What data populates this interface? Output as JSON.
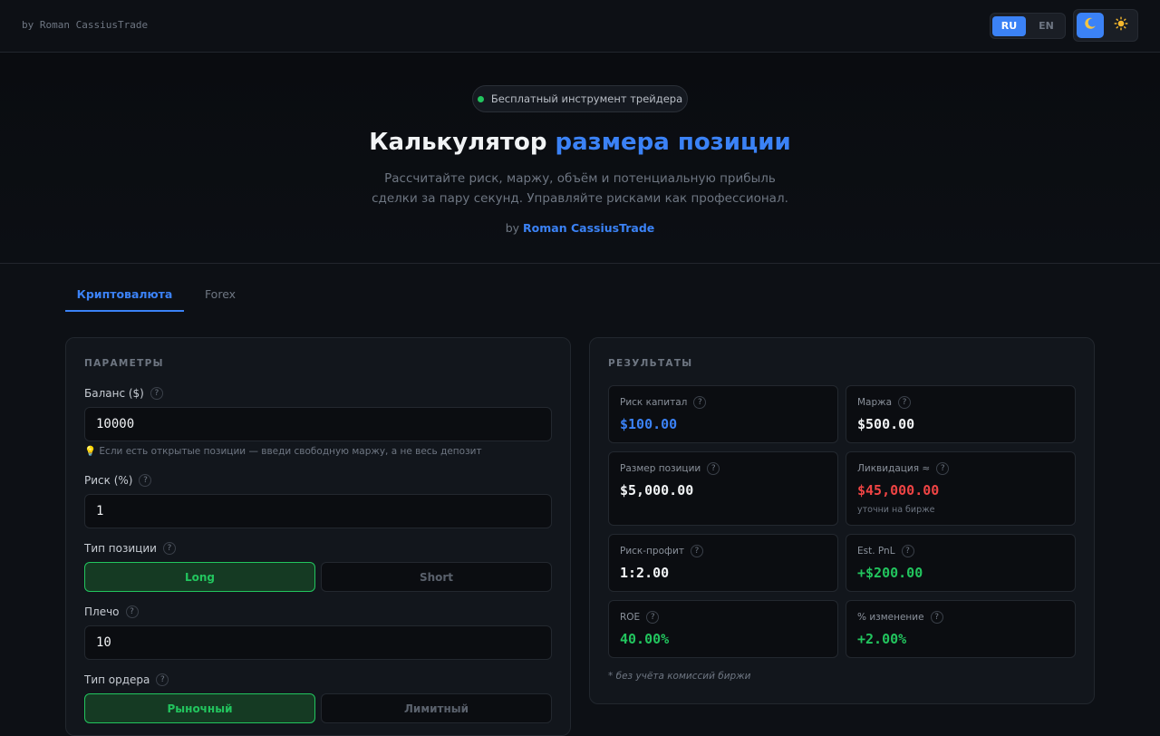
{
  "header": {
    "brand": "by Roman CassiusTrade",
    "languages": [
      {
        "label": "RU",
        "active": true
      },
      {
        "label": "EN",
        "active": false
      }
    ],
    "themes": [
      {
        "icon": "moon-icon",
        "glyph": "🌙",
        "active": true
      },
      {
        "icon": "sun-icon",
        "glyph": "☀️",
        "active": false
      }
    ]
  },
  "hero": {
    "badge": "Бесплатный инструмент трейдера",
    "title_main": "Калькулятор ",
    "title_accent": "размера позиции",
    "subtitle": "Рассчитайте риск, маржу, объём и потенциальную прибыль сделки за пару секунд. Управляйте рисками как профессионал.",
    "by_prefix": "by ",
    "by_name": "Roman CassiusTrade"
  },
  "tabs": [
    {
      "label": "Криптовалюта",
      "active": true
    },
    {
      "label": "Forex",
      "active": false
    }
  ],
  "params": {
    "heading": "ПАРАМЕТРЫ",
    "balance": {
      "label": "Баланс ($)",
      "value": "10000"
    },
    "balance_hint": "💡 Если есть открытые позиции — введи свободную маржу, а не весь депозит",
    "risk": {
      "label": "Риск (%)",
      "value": "1"
    },
    "position_type": {
      "label": "Тип позиции",
      "options": [
        "Long",
        "Short"
      ],
      "selected": "Long"
    },
    "leverage": {
      "label": "Плечо",
      "value": "10"
    },
    "order_type": {
      "label": "Тип ордера",
      "options": [
        "Рыночный",
        "Лимитный"
      ],
      "selected": "Рыночный"
    }
  },
  "results": {
    "heading": "РЕЗУЛЬТАТЫ",
    "cards": [
      {
        "label": "Риск капитал",
        "value": "$100.00",
        "color": "#3b82f6"
      },
      {
        "label": "Маржа",
        "value": "$500.00",
        "color": "#f1f3f5"
      },
      {
        "label": "Размер позиции",
        "value": "$5,000.00",
        "color": "#f1f3f5"
      },
      {
        "label": "Ликвидация ≈",
        "value": "$45,000.00",
        "color": "#ef4444",
        "note": "уточни на бирже"
      },
      {
        "label": "Риск-профит",
        "value": "1:2.00",
        "color": "#f1f3f5"
      },
      {
        "label": "Est. PnL",
        "value": "+$200.00",
        "color": "#22c55e"
      },
      {
        "label": "ROE",
        "value": "40.00%",
        "color": "#22c55e"
      },
      {
        "label": "% изменение",
        "value": "+2.00%",
        "color": "#22c55e"
      }
    ],
    "footnote": "* без учёта комиссий биржи"
  },
  "colors": {
    "accent": "#3b82f6",
    "positive": "#22c55e",
    "negative": "#ef4444",
    "background": "#0d1015"
  }
}
